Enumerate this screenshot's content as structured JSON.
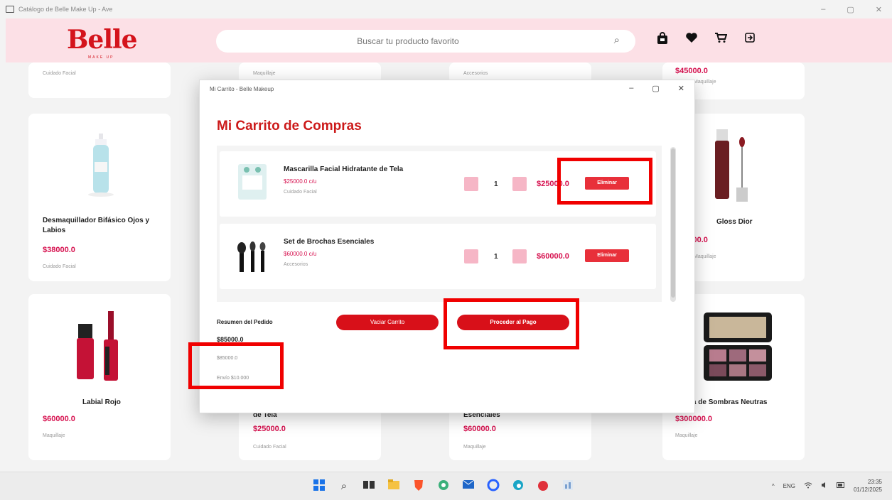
{
  "window": {
    "title": "Catálogo de Belle Make Up - Ave",
    "minimize": "–",
    "maximize": "▢",
    "close": "✕"
  },
  "header": {
    "logo": "Belle",
    "logo_sub": "MAKE UP",
    "search_placeholder": "Buscar tu producto favorito",
    "icons": [
      "bag-icon",
      "heart-icon",
      "cart-icon",
      "logout-icon"
    ]
  },
  "products": [
    {
      "category": "Cuidado Facial"
    },
    {
      "category": "Maquillaje"
    },
    {
      "category": "Accesorios"
    },
    {
      "price": "$45000.0",
      "category": "Maquillaje"
    },
    {
      "name": "Desmaquillador Bifásico Ojos y Labios",
      "price": "$38000.0",
      "category": "Cuidado Facial"
    },
    {
      "name": "Gloss Dior",
      "price": "$45000.0",
      "category": "Maquillaje"
    },
    {
      "name": "Labial Rojo",
      "price": "$60000.0",
      "category": "Maquillaje"
    },
    {
      "name": "de Tela",
      "price": "$25000.0",
      "category": "Cuidado Facial"
    },
    {
      "name": "Esenciales",
      "price": "$60000.0",
      "category": "Maquillaje"
    },
    {
      "name": "Paleta de Sombras Neutras",
      "price": "$300000.0",
      "category": "Maquillaje"
    }
  ],
  "cart_dialog": {
    "title": "Mi Carrito - Belle Makeup",
    "heading": "Mi Carrito de Compras",
    "items": [
      {
        "name": "Mascarilla Facial Hidratante de Tela",
        "unit_price": "$25000.0 c/u",
        "category": "Cuidado Facial",
        "qty": "1",
        "total": "$25000.0",
        "delete": "Eliminar"
      },
      {
        "name": "Set de Brochas Esenciales",
        "unit_price": "$60000.0 c/u",
        "category": "Accesorios",
        "qty": "1",
        "total": "$60000.0",
        "delete": "Eliminar"
      }
    ],
    "summary": {
      "title": "Resumen del Pedido",
      "total": "$85000.0",
      "shipping": "$85000.0",
      "note": "Envío $10.000"
    },
    "empty_button": "Vaciar Carrito",
    "checkout_button": "Proceder al Pago"
  },
  "taskbar": {
    "icons": [
      "windows-icon",
      "search-icon",
      "task-view-icon",
      "file-explorer-icon",
      "brave-icon",
      "copilot-icon",
      "mail-icon",
      "opera-icon",
      "edge-icon",
      "app-icon",
      "app-icon-2"
    ],
    "tray_lang": "ENG",
    "time": "23:35",
    "date": "01/12/2025"
  },
  "colors": {
    "brand": "#d4141c",
    "price": "#d6104e",
    "header_bg": "#fce0e6",
    "highlight": "#f00000"
  }
}
